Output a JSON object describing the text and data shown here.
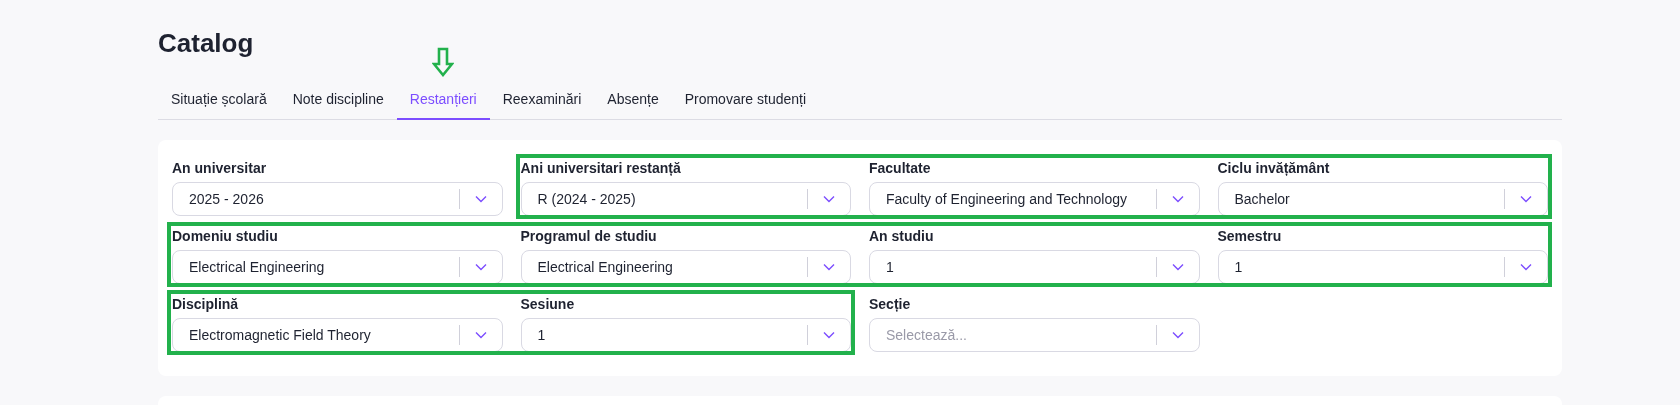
{
  "page": {
    "title": "Catalog"
  },
  "tabs": [
    {
      "label": "Situație școlară",
      "selected": false,
      "marked": false
    },
    {
      "label": "Note discipline",
      "selected": false,
      "marked": false
    },
    {
      "label": "Restanțieri",
      "selected": true,
      "marked": true
    },
    {
      "label": "Reexaminări",
      "selected": false,
      "marked": false
    },
    {
      "label": "Absențe",
      "selected": false,
      "marked": false
    },
    {
      "label": "Promovare studenți",
      "selected": false,
      "marked": false
    }
  ],
  "filters": [
    [
      {
        "label": "An universitar",
        "value": "2025 - 2026",
        "highlighted": false
      },
      {
        "label": "Ani universitari restanță",
        "value": "R (2024 - 2025)",
        "highlighted": true
      },
      {
        "label": "Facultate",
        "value": "Faculty of Engineering and Technology",
        "highlighted": true
      },
      {
        "label": "Ciclu invățământ",
        "value": "Bachelor",
        "highlighted": true
      }
    ],
    [
      {
        "label": "Domeniu studiu",
        "value": "Electrical Engineering",
        "highlighted": true
      },
      {
        "label": "Programul de studiu",
        "value": "Electrical Engineering",
        "highlighted": true
      },
      {
        "label": "An studiu",
        "value": "1",
        "highlighted": true
      },
      {
        "label": "Semestru",
        "value": "1",
        "highlighted": true
      }
    ],
    [
      {
        "label": "Disciplină",
        "value": "Electromagnetic Field Theory",
        "highlighted": true
      },
      {
        "label": "Sesiune",
        "value": "1",
        "highlighted": true
      },
      {
        "label": "Secție",
        "placeholder": "Selectează...",
        "highlighted": false
      }
    ]
  ]
}
